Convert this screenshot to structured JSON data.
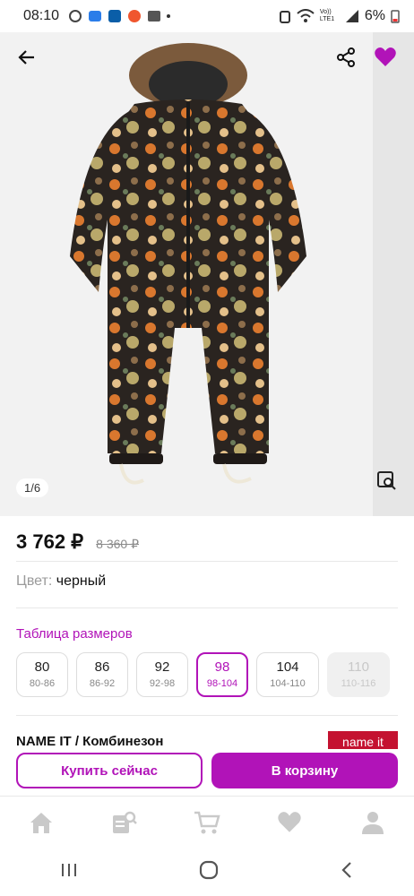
{
  "status_bar": {
    "time": "08:10",
    "battery": "6%",
    "network_label": "Vo)) LTE1"
  },
  "gallery": {
    "counter": "1/6"
  },
  "product": {
    "price": "3 762 ₽",
    "old_price": "8 360 ₽",
    "color_label": "Цвет:",
    "color_value": "черный",
    "size_table_link": "Таблица размеров",
    "sizes": [
      {
        "size": "80",
        "range": "80-86",
        "state": "available"
      },
      {
        "size": "86",
        "range": "86-92",
        "state": "available"
      },
      {
        "size": "92",
        "range": "92-98",
        "state": "available"
      },
      {
        "size": "98",
        "range": "98-104",
        "state": "selected"
      },
      {
        "size": "104",
        "range": "104-110",
        "state": "available"
      },
      {
        "size": "110",
        "range": "110-116",
        "state": "disabled"
      }
    ],
    "title": "NAME IT / Комбинезон",
    "brand_logo": "name it"
  },
  "actions": {
    "buy_now": "Купить сейчас",
    "add_to_cart": "В корзину"
  },
  "colors": {
    "accent": "#b113b8",
    "brand_red": "#c41230"
  },
  "tabbar": [
    "home-icon",
    "catalog-search-icon",
    "cart-icon",
    "favorites-icon",
    "profile-icon"
  ]
}
